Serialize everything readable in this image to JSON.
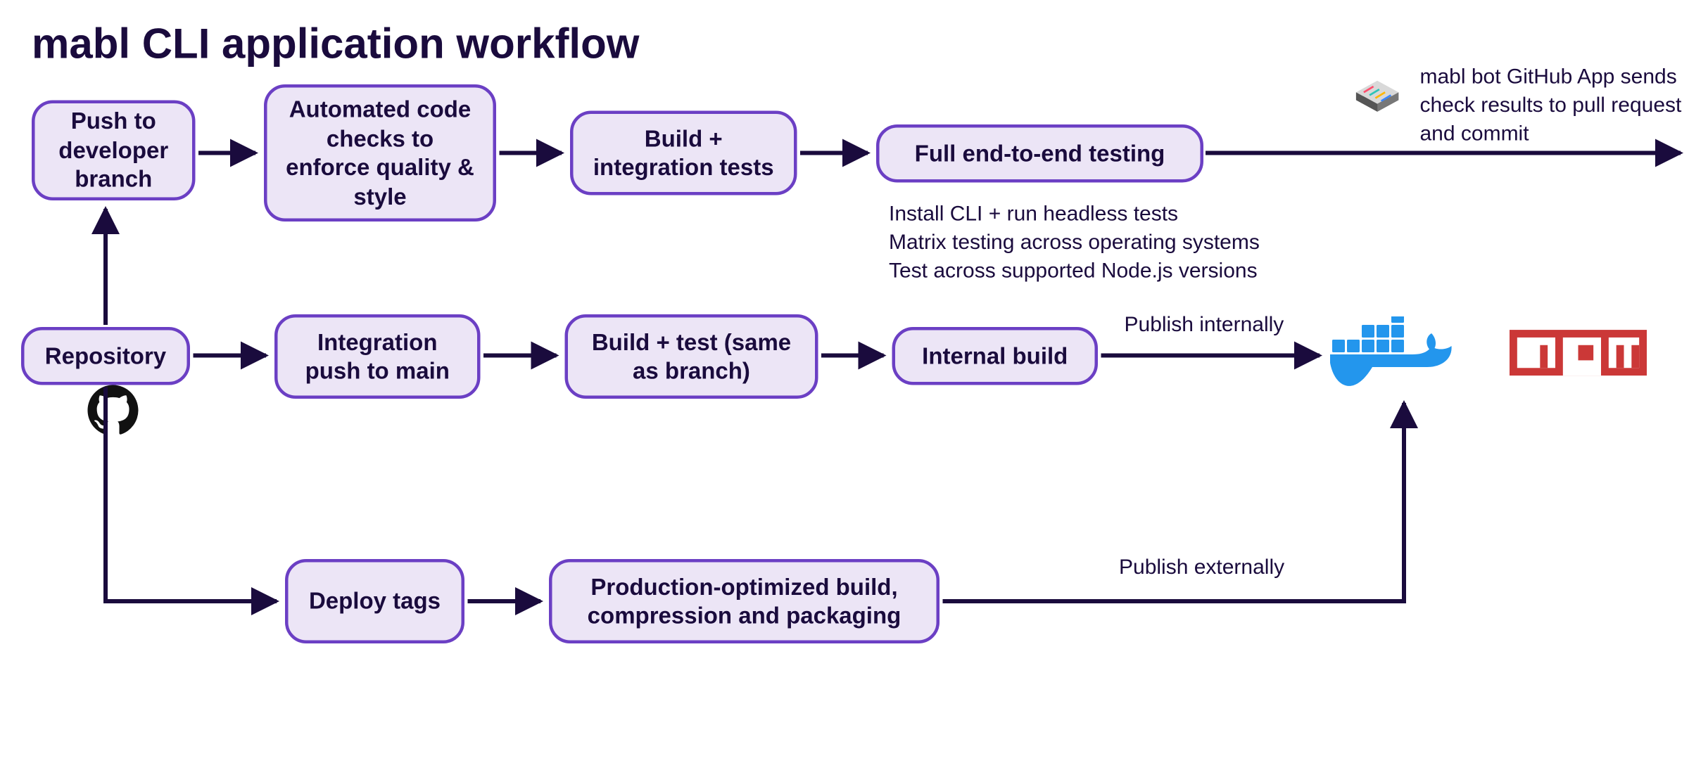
{
  "title": "mabl CLI application workflow",
  "nodes": {
    "push_branch": "Push to developer branch",
    "code_checks": "Automated code checks to enforce quality & style",
    "build_integration": "Build + integration tests",
    "e2e": "Full end-to-end testing",
    "repository": "Repository",
    "integration_main": "Integration push to main",
    "build_test_same": "Build + test (same as branch)",
    "internal_build": "Internal build",
    "deploy_tags": "Deploy tags",
    "prod_build": "Production-optimized build, compression and packaging"
  },
  "labels": {
    "e2e_details_1": "Install CLI + run headless tests",
    "e2e_details_2": "Matrix testing across operating systems",
    "e2e_details_3": "Test across supported Node.js versions",
    "bot_note": "mabl bot GitHub App sends check results to pull request and commit",
    "publish_internal": "Publish internally",
    "publish_external": "Publish externally"
  },
  "icons": {
    "github": "github-icon",
    "docker": "docker-icon",
    "npm": "npm-icon",
    "bot": "mabl-bot-icon"
  }
}
